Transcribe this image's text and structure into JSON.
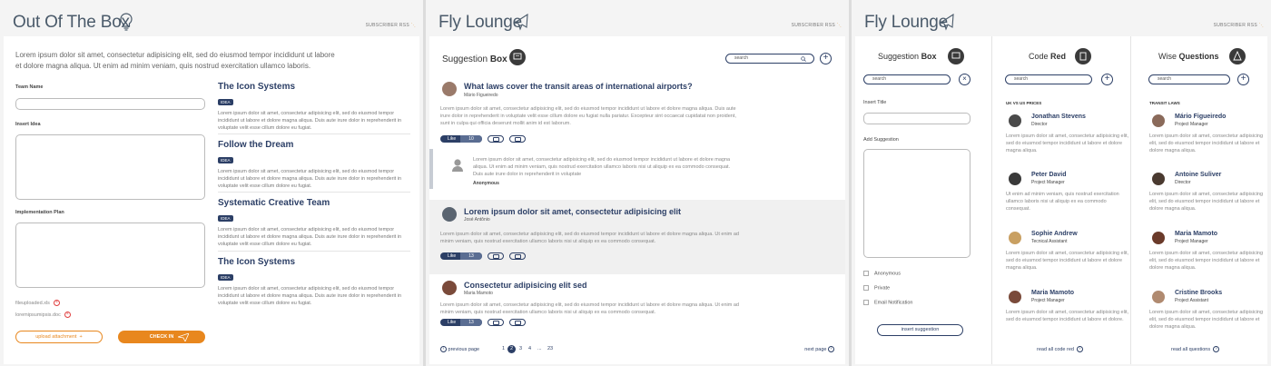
{
  "p1": {
    "title": "Out Of The Box",
    "rss": "SUBSCRIBER RSS",
    "intro": "Lorem ipsum dolor sit amet, consectetur adipisicing elit, sed do eiusmod tempor incididunt ut labore et dolore magna aliqua. Ut enim ad minim veniam, quis nostrud exercitation ullamco laboris.",
    "team_name_label": "Team Name",
    "insert_idea_label": "Insert Idea",
    "plan_label": "Implementation Plan",
    "files": [
      "fileuploaded.xls",
      "loremipsumipsis.doc"
    ],
    "upload_btn": "upload attachment",
    "checkin_btn": "CHECK IN",
    "ideas": [
      {
        "title": "The Icon Systems",
        "badge": "IDEA",
        "text": "Lorem ipsum dolor sit amet, consectetur adipisicing elit, sed do eiusmod tempor incididunt ut labore et dolore magna aliqua. Duis aute irure dolor in reprehenderit in voluptate velit esse cillum dolore eu fugiat."
      },
      {
        "title": "Follow the Dream",
        "badge": "IDEA",
        "text": "Lorem ipsum dolor sit amet, consectetur adipisicing elit, sed do eiusmod tempor incididunt ut labore et dolore magna aliqua. Duis aute irure dolor in reprehenderit in voluptate velit esse cillum dolore eu fugiat."
      },
      {
        "title": "Systematic Creative Team",
        "badge": "IDEA",
        "text": "Lorem ipsum dolor sit amet, consectetur adipisicing elit, sed do eiusmod tempor incididunt ut labore et dolore magna aliqua. Duis aute irure dolor in reprehenderit in voluptate velit esse cillum dolore eu fugiat."
      },
      {
        "title": "The Icon Systems",
        "badge": "IDEA",
        "text": "Lorem ipsum dolor sit amet, consectetur adipisicing elit, sed do eiusmod tempor incididunt ut labore et dolore magna aliqua. Duis aute irure dolor in reprehenderit in voluptate velit esse cillum dolore eu fugiat."
      }
    ]
  },
  "p2": {
    "title": "Fly Lounge",
    "rss": "SUBSCRIBER RSS",
    "head_a": "Suggestion",
    "head_b": "Box",
    "search_placeholder": "search",
    "posts": [
      {
        "title": "What laws cover the transit areas of international airports?",
        "author": "Mário Figueiredo",
        "text": "Lorem ipsum dolor sit amet, consectetur adipisicing elit, sed do eiusmod tempor incididunt ut labore et dolore magna aliqua. Duis aute irure dolor in reprehenderit in voluptate velit esse cillum dolore eu fugiat nulla pariatur. Excepteur sint occaecat cupidatat non proident, sunt in culpa qui officia deserunt mollit anim id est laborum.",
        "like": "Like",
        "count": "10"
      },
      {
        "title": "Lorem ipsum dolor sit amet, consectetur adipisicing elit",
        "author": "José Antônio",
        "text": "Lorem ipsum dolor sit amet, consectetur adipisicing elit, sed do eiusmod tempor incididunt ut labore et dolore magna aliqua. Ut enim ad minim veniam, quis nostrud exercitation ullamco laboris nisi ut aliquip ex ea commodo consequat.",
        "like": "Like",
        "count": "13"
      },
      {
        "title": "Consectetur adipisicing elit sed",
        "author": "Maria Mamoto",
        "text": "Lorem ipsum dolor sit amet, consectetur adipisicing elit, sed do eiusmod tempor incididunt ut labore et dolore magna aliqua. Ut enim ad minim veniam, quis nostrud exercitation ullamco laboris nisi ut aliquip ex ea commodo consequat.",
        "like": "Like",
        "count": "13"
      }
    ],
    "reply": {
      "text": "Lorem ipsum dolor sit amet, consectetur adipisicing elit, sed do eiusmod tempor incididunt ut labore et dolore magna aliqua. Ut enim ad minim veniam, quis nostrud exercitation ullamco laboris nisi ut aliquip ex ea commodo consequat. Duis aute irure dolor in reprehenderit in voluptate",
      "author": "Anonymous"
    },
    "pager": {
      "prev": "previous page",
      "pages": [
        "1",
        "2",
        "3",
        "4",
        "...",
        "23"
      ],
      "next": "next page"
    }
  },
  "p3": {
    "title": "Fly Lounge",
    "rss": "SUBSCRIBER RSS",
    "c1": {
      "head_a": "Suggestion",
      "head_b": "Box",
      "search": "search",
      "title_label": "Insert Title",
      "add_label": "Add Suggestion",
      "checks": [
        "Anonymous",
        "Private",
        "Email Notification"
      ],
      "btn": "insert suggestion"
    },
    "c2": {
      "head_a": "Code",
      "head_b": "Red",
      "search": "search",
      "section": "UK VS US PRICES",
      "readall": "read all code red",
      "people": [
        {
          "name": "Jonathan Stevens",
          "role": "Director",
          "text": "Lorem ipsum dolor sit amet, consectetur adipisicing elit, sed do eiusmod tempor incididunt ut labore et dolore magna aliqua."
        },
        {
          "name": "Peter David",
          "role": "Project Manager",
          "text": "Ut enim ad minim veniam, quis nostrud exercitation ullamco laboris nisi ut aliquip ex ea commodo consequat."
        },
        {
          "name": "Sophie Andrew",
          "role": "Tecnical Assistant",
          "text": "Lorem ipsum dolor sit amet, consectetur adipisicing elit, sed do eiusmod tempor incididunt ut labore et dolore magna aliqua."
        },
        {
          "name": "Maria Mamoto",
          "role": "Project Manager",
          "text": "Lorem ipsum dolor sit amet, consectetur adipisicing elit, sed do eiusmod tempor incididunt ut labore et dolore."
        }
      ]
    },
    "c3": {
      "head_a": "Wise",
      "head_b": "Questions",
      "search": "search",
      "section": "TRANSIT LAWS",
      "readall": "read all questions",
      "people": [
        {
          "name": "Mário Figueiredo",
          "role": "Project Manager",
          "text": "Lorem ipsum dolor sit amet, consectetur adipisicing elit, sed do eiusmod tempor incididunt ut labore et dolore magna aliqua."
        },
        {
          "name": "Antoine Suliver",
          "role": "Director",
          "text": "Lorem ipsum dolor sit amet, consectetur adipisicing elit, sed do eiusmod tempor incididunt ut labore et dolore magna aliqua."
        },
        {
          "name": "Maria Mamoto",
          "role": "Project Manager",
          "text": "Lorem ipsum dolor sit amet, consectetur adipisicing elit, sed do eiusmod tempor incididunt ut labore et dolore magna aliqua."
        },
        {
          "name": "Cristine Brooks",
          "role": "Project Assistant",
          "text": "Lorem ipsum dolor sit amet, consectetur adipisicing elit, sed do eiusmod tempor incididunt ut labore et dolore magna aliqua."
        }
      ]
    }
  },
  "colors": {
    "navy": "#2c3f66",
    "orange": "#e8871e",
    "red": "#e04040"
  }
}
